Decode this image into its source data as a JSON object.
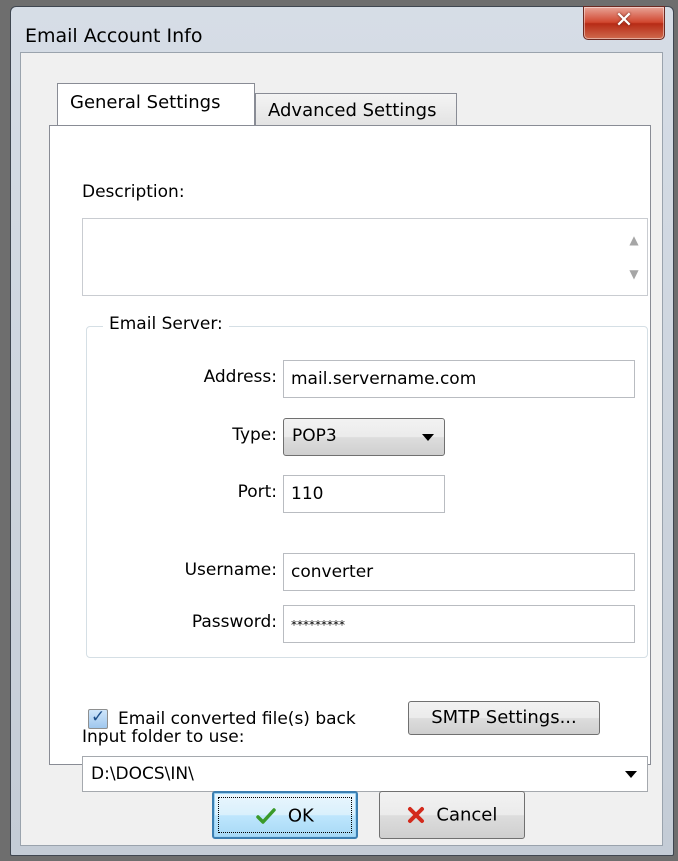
{
  "window": {
    "title": "Email Account Info",
    "close_glyph": "✕"
  },
  "tabs": [
    {
      "label": "General Settings",
      "active": true
    },
    {
      "label": "Advanced Settings",
      "active": false
    }
  ],
  "description": {
    "label": "Description:",
    "value": ""
  },
  "email_server": {
    "legend": "Email Server:",
    "address_label": "Address:",
    "address_value": "mail.servername.com",
    "type_label": "Type:",
    "type_value": "POP3",
    "port_label": "Port:",
    "port_value": "110",
    "username_label": "Username:",
    "username_value": "converter",
    "password_label": "Password:",
    "password_value": "*********"
  },
  "email_back": {
    "checked": true,
    "label": "Email converted file(s) back",
    "smtp_button": "SMTP Settings..."
  },
  "input_folder": {
    "label": "Input folder to use:",
    "value": "D:\\DOCS\\IN\\"
  },
  "buttons": {
    "ok": "OK",
    "cancel": "Cancel"
  },
  "icons": {
    "close": "close-icon",
    "ok": "checkmark-icon",
    "cancel": "red-x-icon",
    "checkbox": "checkmark-icon",
    "scroll_up": "scroll-up-arrow-icon",
    "scroll_down": "scroll-down-arrow-icon",
    "dropdown": "chevron-down-icon"
  },
  "colors": {
    "close_button": "#c9442f",
    "ok_check": "#3a9a2a",
    "cancel_x": "#d32a1c"
  }
}
